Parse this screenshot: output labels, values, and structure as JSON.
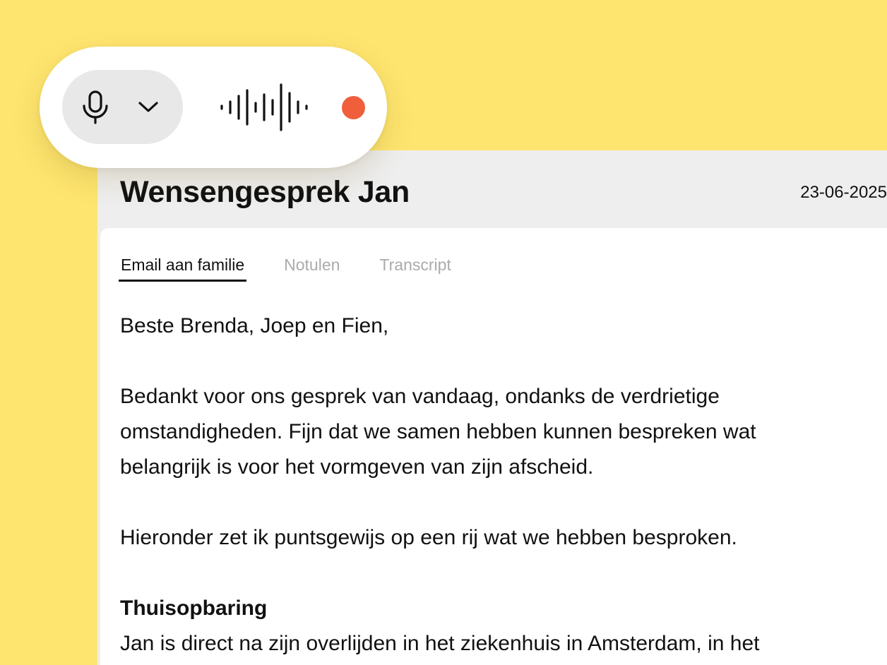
{
  "document": {
    "title": "Wensengesprek Jan",
    "date": "23-06-2025"
  },
  "tabs": [
    {
      "label": "Email aan familie",
      "active": true
    },
    {
      "label": "Notulen",
      "active": false
    },
    {
      "label": "Transcript",
      "active": false
    }
  ],
  "email": {
    "greeting": "Beste Brenda, Joep en Fien,",
    "paragraph_1": [
      "Bedankt voor ons gesprek van vandaag, ondanks de verdrietige",
      "omstandigheden. Fijn dat we samen hebben kunnen bespreken wat",
      "belangrijk is voor het vormgeven van zijn afscheid."
    ],
    "paragraph_2": "Hieronder zet ik puntsgewijs op een rij wat we hebben besproken.",
    "section_heading": "Thuisopbaring",
    "section_text": "Jan is direct na zijn overlijden in het ziekenhuis in Amsterdam, in het"
  },
  "recorder": {
    "icons": {
      "mic": "microphone-icon",
      "dropdown": "chevron-down-icon",
      "waveform": "audio-waveform-icon",
      "status": "recording-indicator"
    },
    "status": "recording"
  },
  "colors": {
    "background": "#FEE56F",
    "header": "#EEEEEE",
    "card": "#FFFFFF",
    "mic_selector": "#E8E8E8",
    "record_dot": "#F05E3B",
    "text": "#111111",
    "inactive_tab": "#ABABAB"
  }
}
